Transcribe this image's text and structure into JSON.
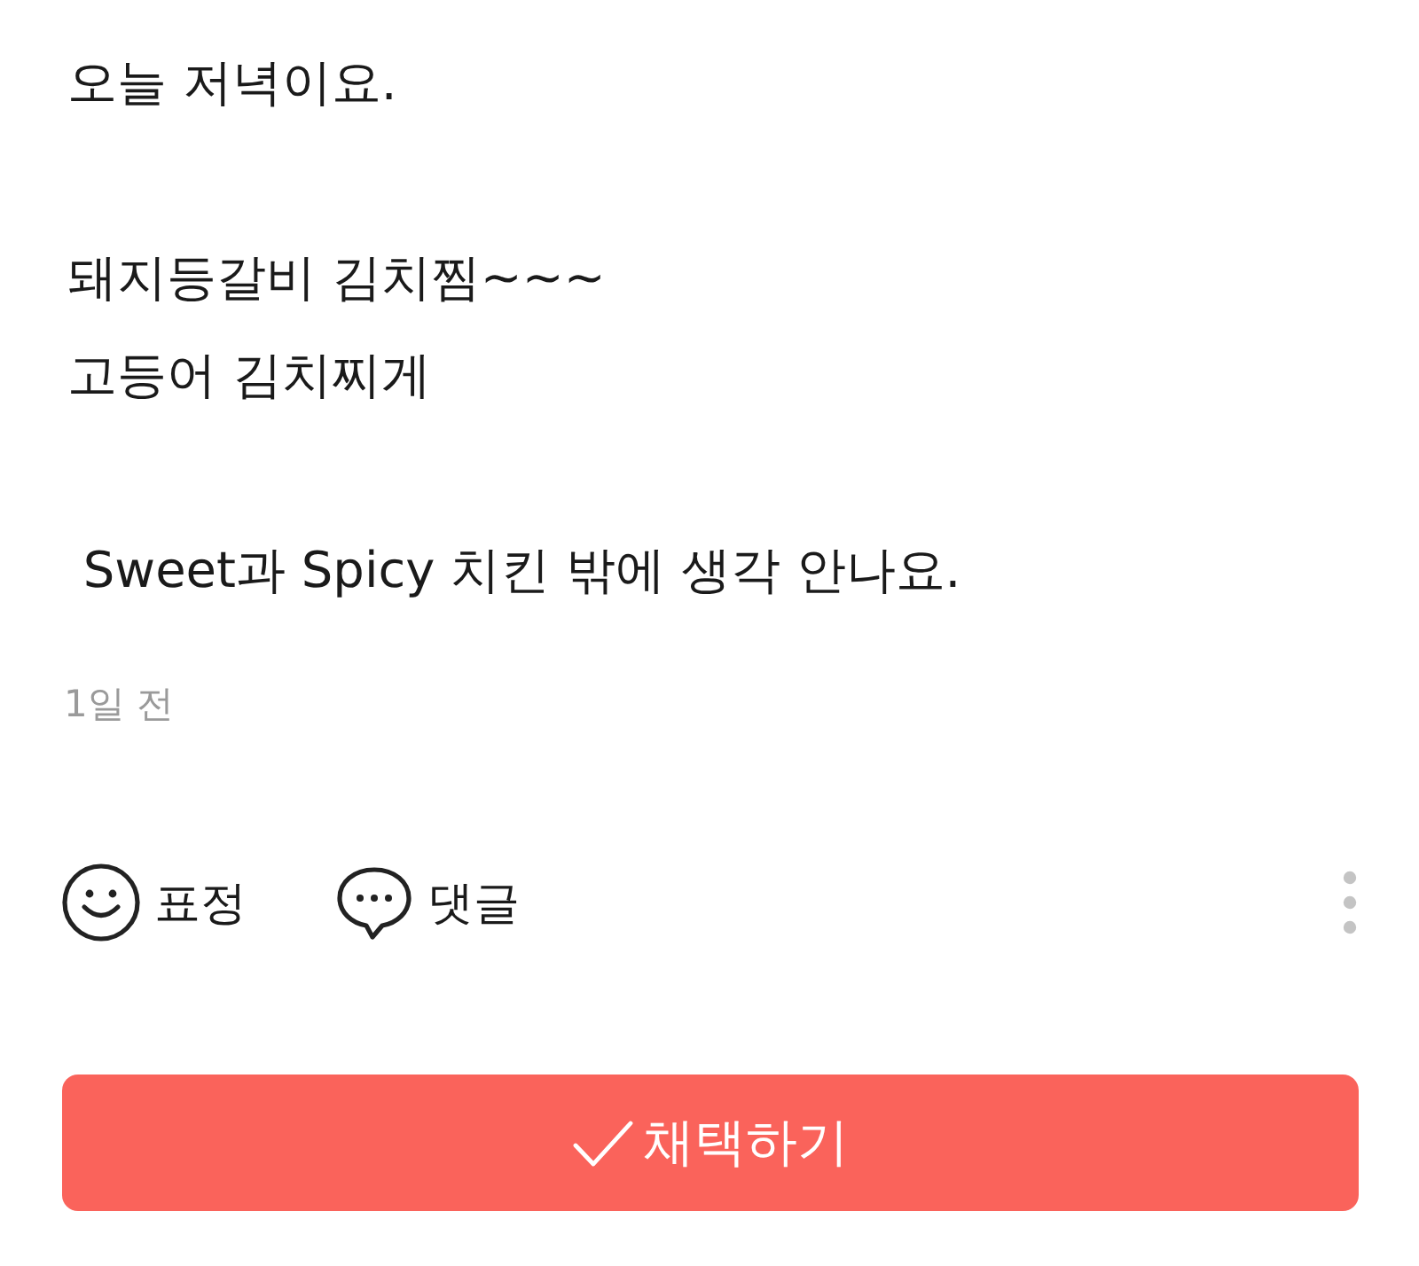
{
  "post": {
    "paragraphs": [
      {
        "lines": [
          "오늘 저녁이요."
        ]
      },
      {
        "lines": [
          "돼지등갈비 김치찜~~~",
          "고등어 김치찌게"
        ]
      },
      {
        "lines": [
          " Sweet과 Spicy 치킨 밖에 생각 안나요."
        ]
      }
    ],
    "time": "1일 전"
  },
  "actions": [
    {
      "kind": "emotion",
      "label": "표정"
    },
    {
      "kind": "comment",
      "label": "댓글"
    }
  ],
  "adopt_button": {
    "label": "채택하기"
  }
}
